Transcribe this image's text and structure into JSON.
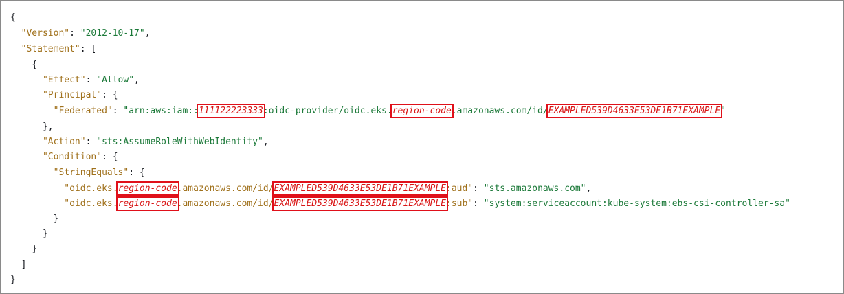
{
  "code": {
    "open_brace": "{",
    "close_brace": "}",
    "open_bracket": "[",
    "close_bracket": "]",
    "colon": ": ",
    "comma": ",",
    "version_key": "\"Version\"",
    "version_value": "\"2012-10-17\"",
    "statement_key": "\"Statement\"",
    "effect_key": "\"Effect\"",
    "effect_value": "\"Allow\"",
    "principal_key": "\"Principal\"",
    "federated_key": "\"Federated\"",
    "federated_value_part1": "\"arn:aws:iam::",
    "account_id": "111122223333",
    "federated_value_part2": ":oidc-provider/oidc.eks.",
    "region_code": "region-code",
    "federated_value_part3": ".amazonaws.com/id/",
    "oidc_id": "EXAMPLED539D4633E53DE1B71EXAMPLE",
    "quote": "\"",
    "action_key": "\"Action\"",
    "action_value": "\"sts:AssumeRoleWithWebIdentity\"",
    "condition_key": "\"Condition\"",
    "string_equals_key": "\"StringEquals\"",
    "cond_key_prefix": "\"oidc.eks.",
    "cond_key_mid": ".amazonaws.com/id/",
    "aud_suffix": ":aud\"",
    "aud_value": "\"sts.amazonaws.com\"",
    "sub_suffix": ":sub\"",
    "sub_value": "\"system:serviceaccount:kube-system:ebs-csi-controller-sa\""
  }
}
